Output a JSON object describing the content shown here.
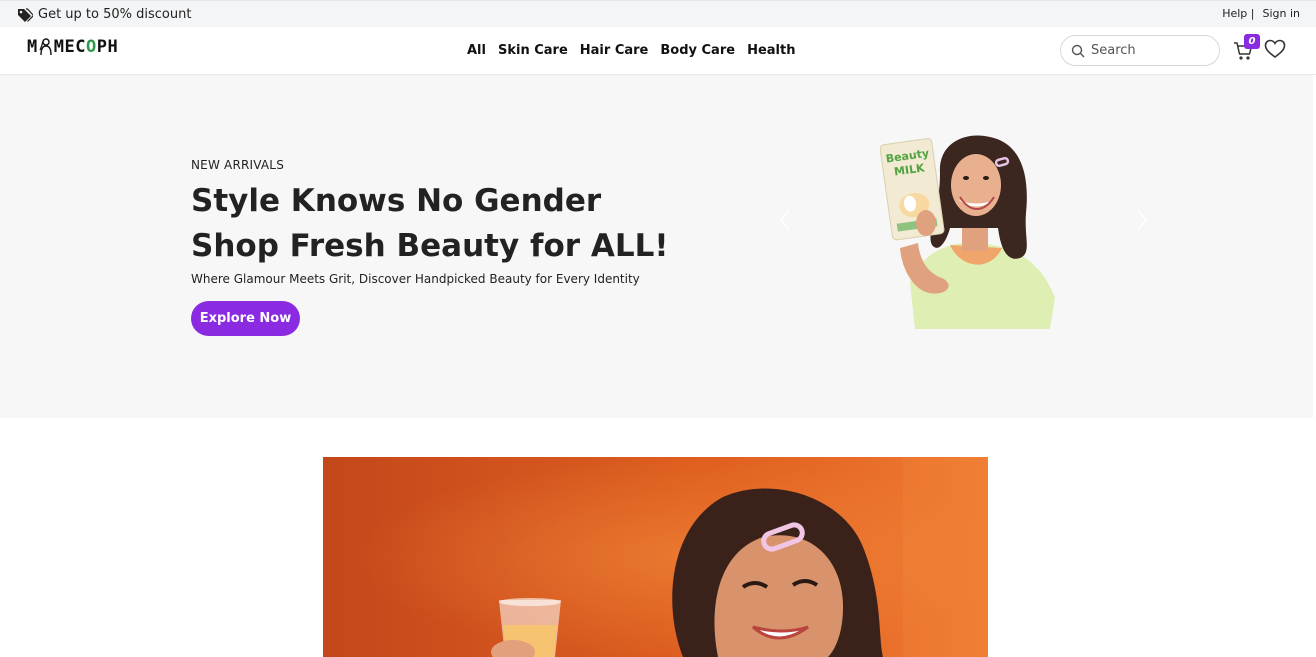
{
  "topbar": {
    "promo_text": "Get up to 50% discount",
    "promo_icon": "tags-icon",
    "help_label": "Help |",
    "signin_label": "Sign in"
  },
  "header": {
    "logo_text_pre": "M",
    "logo_text_mid": "MEC",
    "logo_text_leaf": "O",
    "logo_text_post": "PH",
    "nav": [
      {
        "label": "All"
      },
      {
        "label": "Skin Care"
      },
      {
        "label": "Hair Care"
      },
      {
        "label": "Body Care"
      },
      {
        "label": "Health"
      }
    ],
    "search": {
      "placeholder": "Search",
      "value": ""
    },
    "cart_count": "0",
    "cart_icon": "cart-icon",
    "wishlist_icon": "heart-icon"
  },
  "hero": {
    "kicker": "NEW ARRIVALS",
    "headline_line1": "Style Knows No Gender",
    "headline_line2": "Shop Fresh Beauty for ALL!",
    "subtext": "Where Glamour Meets Grit, Discover Handpicked Beauty for Every Identity",
    "cta_label": "Explore Now",
    "product_label_1": "Beauty",
    "product_label_2": "MILK"
  },
  "colors": {
    "accent": "#8a2be2",
    "hero_bg": "#f7f7f7",
    "banner_orange": "#d8521f",
    "logo_green": "#2e9a47"
  }
}
